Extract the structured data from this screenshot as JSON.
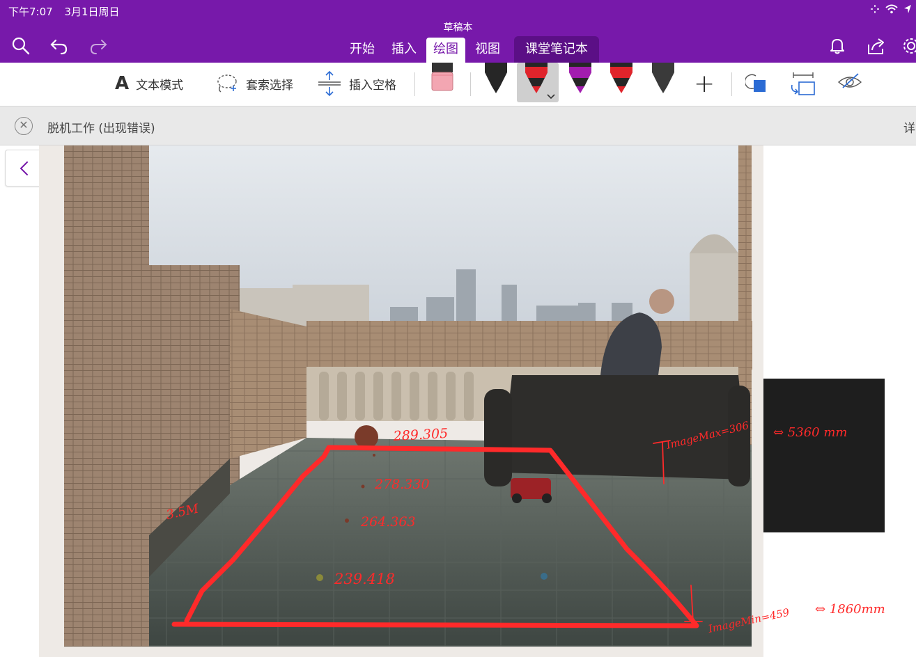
{
  "status_bar": {
    "time": "下午7:07",
    "date": "3月1日周日"
  },
  "document_title": "草稿本",
  "toolbar_icons": [
    "search-icon",
    "undo-icon",
    "redo-icon",
    "bell-icon",
    "share-icon",
    "settings-icon"
  ],
  "tabs": [
    {
      "label": "开始",
      "active": false
    },
    {
      "label": "插入",
      "active": false
    },
    {
      "label": "绘图",
      "active": true
    },
    {
      "label": "视图",
      "active": false
    },
    {
      "label": "课堂笔记本",
      "active": false
    }
  ],
  "ribbon": {
    "text_mode": "文本模式",
    "lasso_select": "套索选择",
    "insert_space": "插入空格",
    "text_mode_glyph": "A",
    "add_pen_glyph": "+"
  },
  "pens": [
    {
      "color": "#222222",
      "selected": false
    },
    {
      "color": "#e0242b",
      "selected": true
    },
    {
      "color": "#a21caf",
      "selected": false
    },
    {
      "color": "#e0242b",
      "selected": false
    },
    {
      "color": "#222222",
      "selected": false
    }
  ],
  "notice": {
    "text": "脱机工作 (出现错误)",
    "detail": "详"
  },
  "annotations": {
    "label_top": "289.305",
    "label_2": "278.330",
    "label_3": "264.363",
    "label_4": "239.418",
    "left_label": "3.5M",
    "image_max": "ImageMax=306",
    "image_max_mm": "⇔ 5360 mm",
    "image_min": "ImageMin=459",
    "image_min_mm": "⇔ 1860mm"
  },
  "colors": {
    "brand": "#7719aa",
    "ink": "#ff2a2a"
  }
}
